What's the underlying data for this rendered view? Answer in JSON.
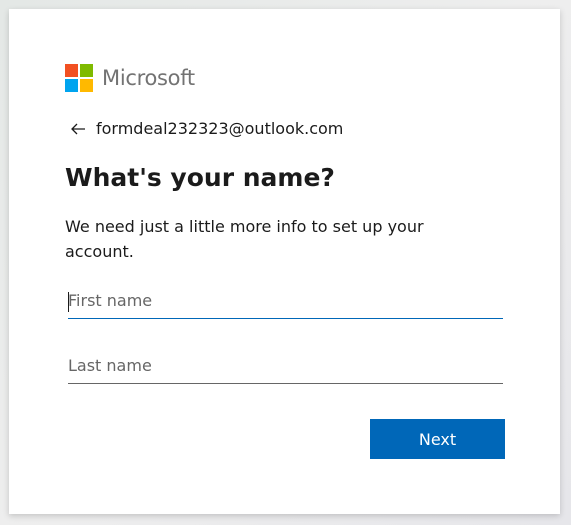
{
  "brand": {
    "name": "Microsoft",
    "colors": {
      "red": "#f25022",
      "green": "#7fba00",
      "blue": "#00a4ef",
      "yellow": "#ffb900"
    }
  },
  "identity": {
    "back_icon": "arrow-left-icon",
    "email": "formdeal232323@outlook.com"
  },
  "heading": "What's your name?",
  "description": "We need just a little more info to set up your account.",
  "form": {
    "first_name": {
      "placeholder": "First name",
      "value": ""
    },
    "last_name": {
      "placeholder": "Last name",
      "value": ""
    }
  },
  "actions": {
    "next_label": "Next"
  },
  "theme": {
    "accent": "#0067b8"
  }
}
